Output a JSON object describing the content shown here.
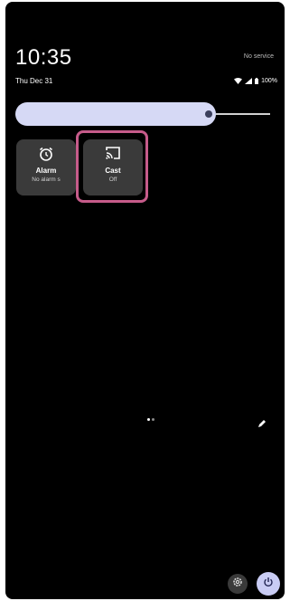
{
  "status": {
    "time": "10:35",
    "date": "Thu Dec 31",
    "carrier": "No service",
    "battery": "100%"
  },
  "brightness": {
    "level": 0.78
  },
  "tiles": [
    {
      "label": "Alarm",
      "sub": "No alarm s",
      "icon": "alarm-icon"
    },
    {
      "label": "Cast",
      "sub": "Off",
      "icon": "cast-icon"
    }
  ],
  "colors": {
    "background": "#000000",
    "tile": "#3a3a3a",
    "brightness_fill": "#d6d9f5",
    "highlight": "#c65b8a",
    "power_button": "#c9ccf4"
  },
  "icons": {
    "wifi": "wifi-icon",
    "signal": "signal-icon",
    "battery": "battery-icon",
    "edit": "edit-icon",
    "settings": "settings-icon",
    "power": "power-icon"
  }
}
